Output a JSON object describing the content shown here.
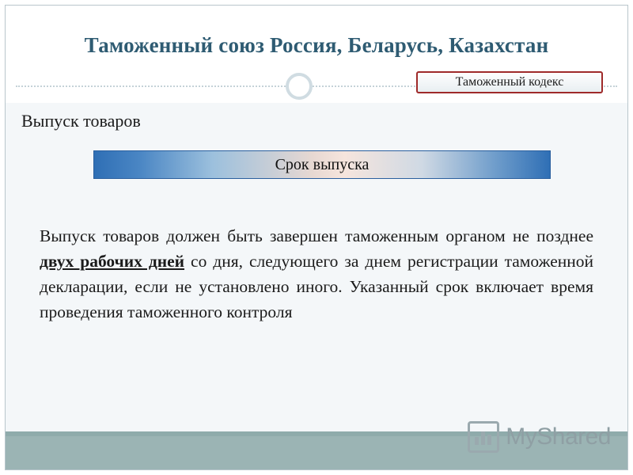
{
  "slide": {
    "title": "Таможенный союз Россия, Беларусь, Казахстан",
    "tag_label": "Таможенный кодекс",
    "subtitle": "Выпуск товаров",
    "banner_label": "Срок выпуска",
    "body": {
      "part1": "Выпуск товаров должен быть завершен таможенным органом не позднее ",
      "highlight": "двух рабочих дней",
      "part2": " со дня, следующего за днем регистрации таможенной декларации, если не установлено иного. Указанный срок включает время проведения таможенного контроля"
    },
    "watermark_text": "MyShared",
    "colors": {
      "title": "#2e5b72",
      "tag_border": "#9f2a2a",
      "banner_edge": "#2f6fb5",
      "bottom_bar": "#9bb4b4",
      "watermark": "#8f9fa4"
    }
  }
}
